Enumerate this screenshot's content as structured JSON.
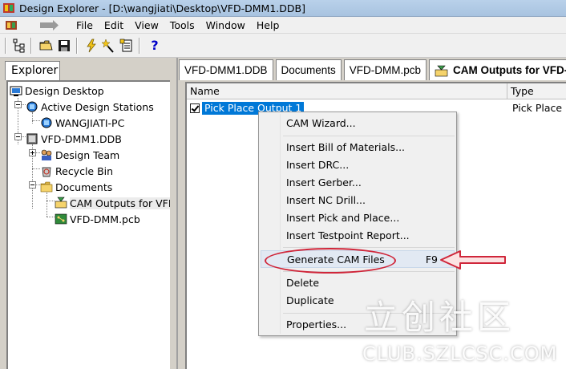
{
  "window": {
    "title": "Design Explorer - [D:\\wangjiati\\Desktop\\VFD-DMM1.DDB]"
  },
  "menu": {
    "items": [
      "File",
      "Edit",
      "View",
      "Tools",
      "Window",
      "Help"
    ]
  },
  "toolbar": {
    "icons": [
      "tree-toggle-icon",
      "open-folder-icon",
      "save-disk-icon",
      "lightning-icon",
      "wand-icon",
      "document-list-icon",
      "help-question-icon"
    ],
    "help_glyph": "?"
  },
  "explorer": {
    "tab_label": "Explorer",
    "tree": [
      {
        "label": "Design Desktop",
        "icon": "desktop-icon"
      },
      {
        "label": "Active Design Stations",
        "icon": "workstations-icon"
      },
      {
        "label": "WANGJIATI-PC",
        "icon": "workstation-icon"
      },
      {
        "label": "VFD-DMM1.DDB",
        "icon": "database-icon"
      },
      {
        "label": "Design Team",
        "icon": "team-icon"
      },
      {
        "label": "Recycle Bin",
        "icon": "recycle-bin-icon"
      },
      {
        "label": "Documents",
        "icon": "folder-icon"
      },
      {
        "label": "CAM Outputs for VFD",
        "icon": "cam-outputs-icon"
      },
      {
        "label": "VFD-DMM.pcb",
        "icon": "pcb-icon"
      }
    ]
  },
  "tabs": [
    "VFD-DMM1.DDB",
    "Documents",
    "VFD-DMM.pcb",
    "CAM Outputs for VFD-D"
  ],
  "grid": {
    "columns": [
      "Name",
      "Type"
    ],
    "rows": [
      {
        "name": "Pick Place Output 1",
        "type": "Pick Place",
        "checked": true
      }
    ]
  },
  "context_menu": {
    "items": [
      {
        "label": "CAM Wizard...",
        "shortcut": ""
      },
      {
        "label": "Insert Bill of Materials...",
        "shortcut": ""
      },
      {
        "label": "Insert DRC...",
        "shortcut": ""
      },
      {
        "label": "Insert Gerber...",
        "shortcut": ""
      },
      {
        "label": "Insert NC Drill...",
        "shortcut": ""
      },
      {
        "label": "Insert Pick and Place...",
        "shortcut": ""
      },
      {
        "label": "Insert Testpoint Report...",
        "shortcut": ""
      },
      {
        "label": "Generate CAM Files",
        "shortcut": "F9"
      },
      {
        "label": "Delete",
        "shortcut": ""
      },
      {
        "label": "Duplicate",
        "shortcut": ""
      },
      {
        "label": "Properties...",
        "shortcut": ""
      }
    ]
  },
  "colors": {
    "annotation_red": "#d0263a",
    "selection_blue": "#0078d7"
  },
  "watermark": {
    "chinese": "立创社区",
    "url": "CLUB.SZLCSC.COM"
  }
}
